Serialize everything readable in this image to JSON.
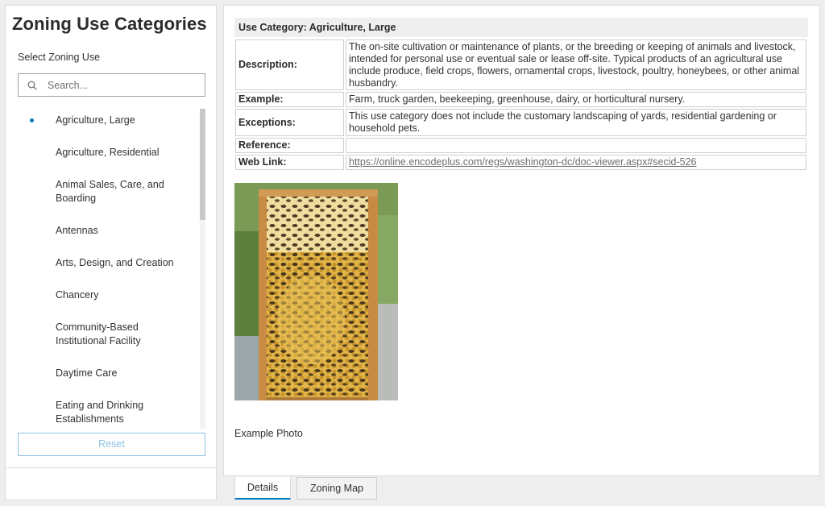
{
  "left": {
    "title": "Zoning Use Categories",
    "subtitle": "Select Zoning Use",
    "search_placeholder": "Search...",
    "items": [
      {
        "label": "Agriculture, Large",
        "selected": true
      },
      {
        "label": "Agriculture, Residential",
        "selected": false
      },
      {
        "label": "Animal Sales, Care, and Boarding",
        "selected": false
      },
      {
        "label": "Antennas",
        "selected": false
      },
      {
        "label": "Arts, Design, and Creation",
        "selected": false
      },
      {
        "label": "Chancery",
        "selected": false
      },
      {
        "label": "Community-Based Institutional Facility",
        "selected": false
      },
      {
        "label": "Daytime Care",
        "selected": false
      },
      {
        "label": "Eating and Drinking Establishments",
        "selected": false
      }
    ],
    "reset_label": "Reset"
  },
  "detail": {
    "header": "Use Category: Agriculture, Large",
    "rows": {
      "description_label": "Description:",
      "description_value": "The on-site cultivation or maintenance of plants, or the breeding or keeping of animals and livestock, intended for personal use or eventual sale or lease off-site. Typical products of an agricultural use include produce, field crops, flowers, ornamental crops, livestock, poultry, honeybees, or other animal husbandry.",
      "example_label": "Example:",
      "example_value": "Farm, truck garden, beekeeping, greenhouse, dairy, or horticultural nursery.",
      "exceptions_label": "Exceptions:",
      "exceptions_value": "This use category does not include the customary landscaping of yards, residential gardening or household pets.",
      "reference_label": "Reference:",
      "reference_value": "",
      "weblink_label": "Web Link:",
      "weblink_value": "https://online.encodeplus.com/regs/washington-dc/doc-viewer.aspx#secid-526"
    },
    "photo_caption": "Example Photo"
  },
  "tabs": {
    "details": "Details",
    "zoning_map": "Zoning Map",
    "active": "details"
  },
  "colors": {
    "accent": "#0079c1",
    "reset_border": "#8fc2e3"
  }
}
